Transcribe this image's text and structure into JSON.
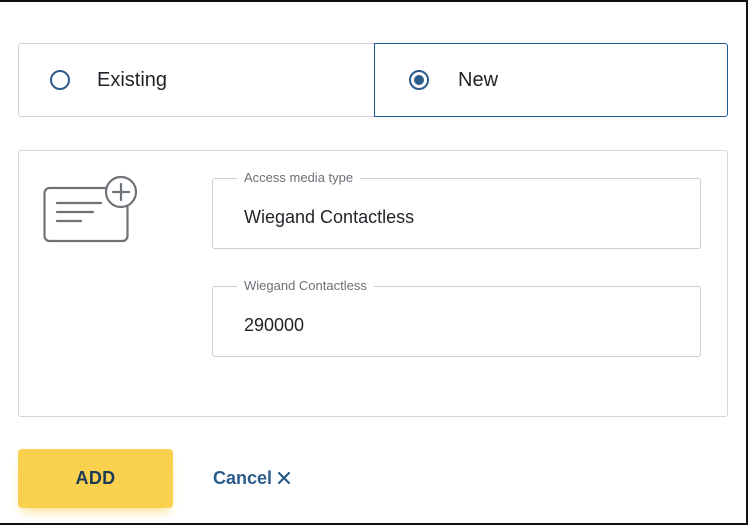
{
  "media_choice": {
    "options": [
      {
        "label": "Existing",
        "selected": false
      },
      {
        "label": "New",
        "selected": true
      }
    ]
  },
  "form": {
    "icon": "card-add-icon",
    "access_media_type": {
      "label": "Access media type",
      "value": "Wiegand Contactless"
    },
    "card_number": {
      "label": "Wiegand Contactless",
      "value": "290000"
    }
  },
  "actions": {
    "add_label": "ADD",
    "cancel_label": "Cancel",
    "cancel_icon": "close-icon"
  },
  "colors": {
    "accent_blue": "#2b5c8a",
    "add_button": "#fad14f",
    "border": "#cfd3d7"
  }
}
